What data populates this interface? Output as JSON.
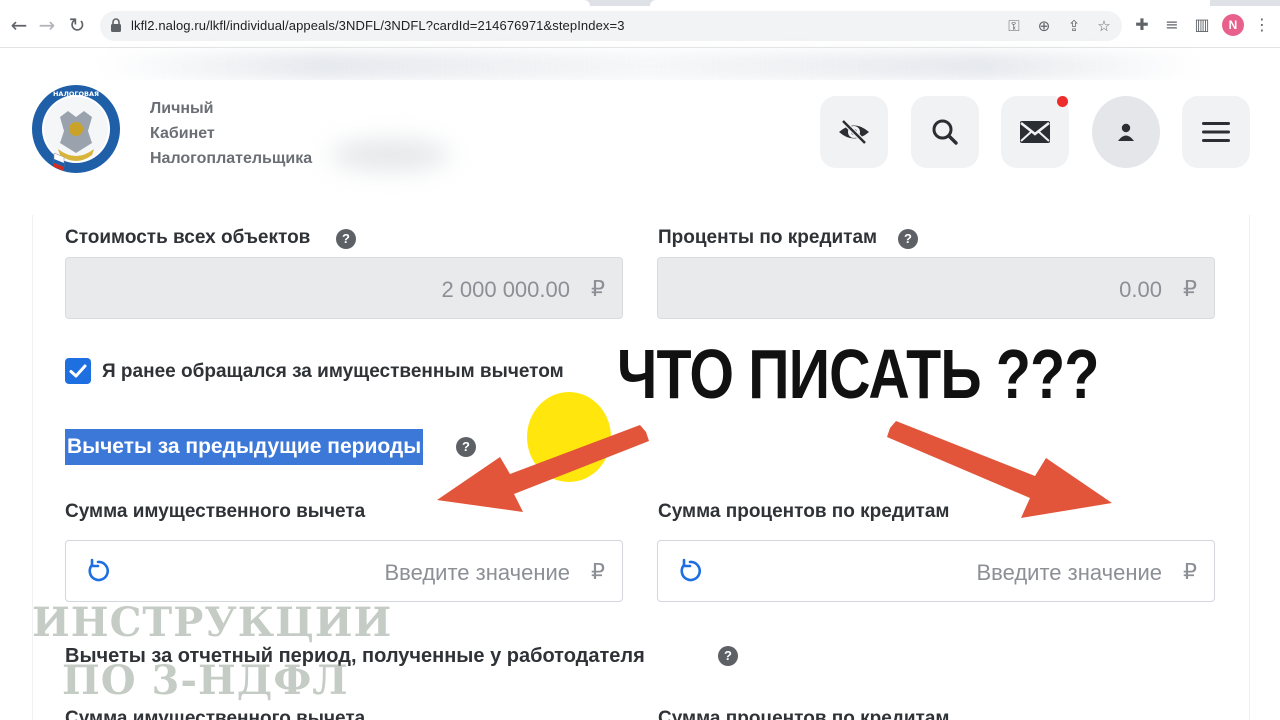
{
  "browser": {
    "url": "lkfl2.nalog.ru/lkfl/individual/appeals/3NDFL/3NDFL?cardId=214676971&stepIndex=3",
    "profile_initial": "N"
  },
  "header": {
    "brand_lines": [
      "Личный",
      "Кабинет",
      "Налогоплательщика"
    ],
    "logo_text": "ФЕДЕРАЛЬНАЯ НАЛОГОВАЯ СЛУЖБА"
  },
  "form": {
    "cost_label": "Стоимость всех объектов",
    "cost_value": "2 000 000.00",
    "interest_label": "Проценты по кредитам",
    "interest_value": "0.00",
    "currency": "₽",
    "help_glyph": "?",
    "checkbox_label": "Я ранее обращался за имущественным вычетом",
    "checkbox_checked": true,
    "prev_section_title": "Вычеты за предыдущие периоды",
    "prev_deduction_label": "Сумма имущественного вычета",
    "prev_interest_label": "Сумма процентов по кредитам",
    "input_placeholder": "Введите значение",
    "employer_section_title": "Вычеты за отчетный период, полученные у работодателя",
    "employer_deduction_label": "Сумма имущественного вычета",
    "employer_interest_label": "Сумма процентов по кредитам"
  },
  "overlay": {
    "caption": "ЧТО ПИСАТЬ ???",
    "watermark_line1": "ИНСТРУКЦИИ",
    "watermark_line2": "ПО 3-НДФЛ"
  },
  "colors": {
    "accent": "#1e6fe0",
    "selection": "#3c78d8",
    "arrow": "#e2553a",
    "highlight": "#ffe600"
  }
}
